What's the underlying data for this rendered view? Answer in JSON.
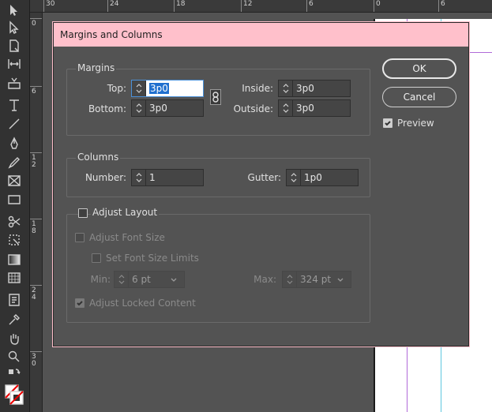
{
  "ruler_top": {
    "ticks": [
      "30",
      "24",
      "18",
      "12",
      "6",
      "0",
      "6"
    ]
  },
  "ruler_left": {
    "ticks": [
      "0",
      "6",
      "1\n2",
      "1\n8",
      "2\n4",
      "3\n0"
    ]
  },
  "dialog": {
    "title": "Margins and Columns",
    "margins": {
      "group_label": "Margins",
      "top_label": "Top:",
      "top_value": "3p0",
      "bottom_label": "Bottom:",
      "bottom_value": "3p0",
      "inside_label": "Inside:",
      "inside_value": "3p0",
      "outside_label": "Outside:",
      "outside_value": "3p0"
    },
    "columns": {
      "group_label": "Columns",
      "number_label": "Number:",
      "number_value": "1",
      "gutter_label": "Gutter:",
      "gutter_value": "1p0"
    },
    "adjust_layout": {
      "label": "Adjust Layout",
      "checked": false,
      "adjust_font_size_label": "Adjust Font Size",
      "set_font_size_limits_label": "Set Font Size Limits",
      "min_label": "Min:",
      "min_value": "6 pt",
      "max_label": "Max:",
      "max_value": "324 pt",
      "adjust_locked_label": "Adjust Locked Content"
    },
    "buttons": {
      "ok": "OK",
      "cancel": "Cancel"
    },
    "preview": {
      "label": "Preview",
      "checked": true
    }
  },
  "colors": {
    "titlebar": "#ffc0cb",
    "dialog_bg": "#535353",
    "margin_guide": "#b06ad8",
    "column_guide": "#5fc8e0"
  }
}
